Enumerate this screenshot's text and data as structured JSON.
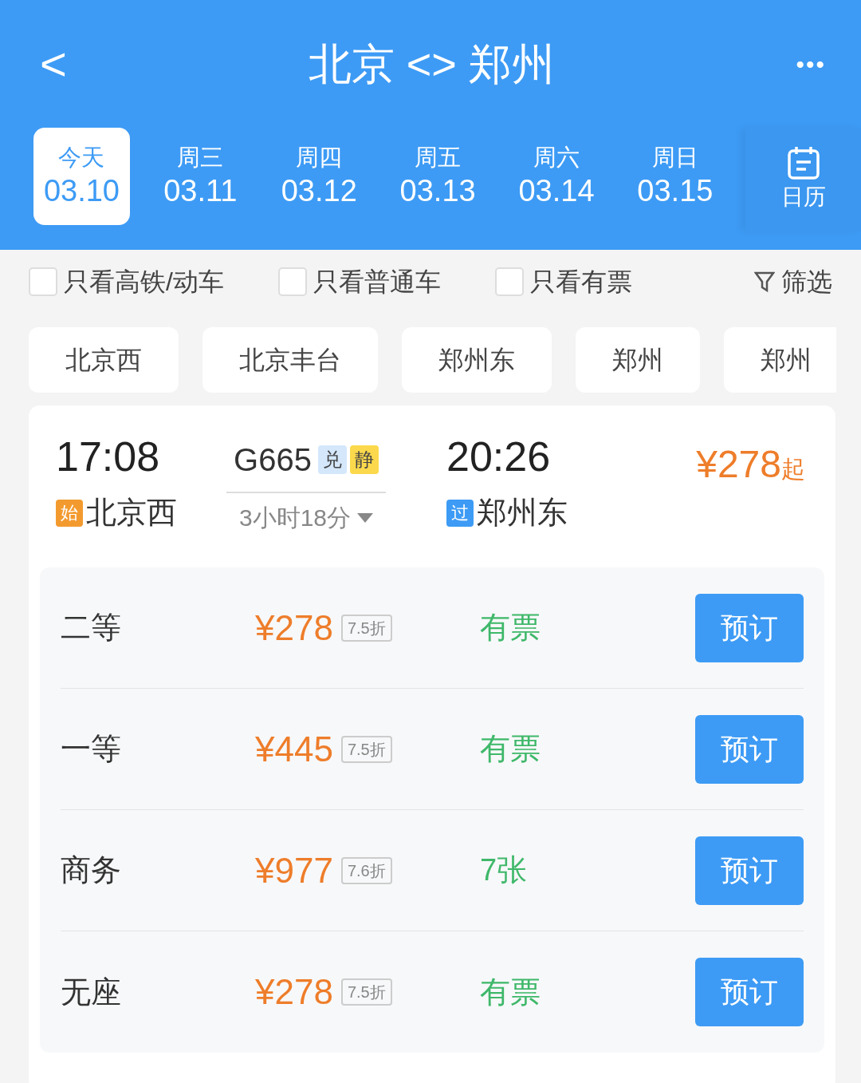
{
  "header": {
    "back": "<",
    "title": "北京 <> 郑州",
    "more": "•••"
  },
  "dates": [
    {
      "weekday": "今天",
      "date": "03.10",
      "selected": true
    },
    {
      "weekday": "周三",
      "date": "03.11",
      "selected": false
    },
    {
      "weekday": "周四",
      "date": "03.12",
      "selected": false
    },
    {
      "weekday": "周五",
      "date": "03.13",
      "selected": false
    },
    {
      "weekday": "周六",
      "date": "03.14",
      "selected": false
    },
    {
      "weekday": "周日",
      "date": "03.15",
      "selected": false
    }
  ],
  "calendar_label": "日历",
  "filters": [
    {
      "label": "只看高铁/动车",
      "checked": false
    },
    {
      "label": "只看普通车",
      "checked": false
    },
    {
      "label": "只看有票",
      "checked": false
    }
  ],
  "filter_button": "筛选",
  "stations": [
    "北京西",
    "北京丰台",
    "郑州东",
    "郑州",
    "郑州"
  ],
  "train": {
    "depart_time": "17:08",
    "depart_station": {
      "tag": "始",
      "kind": "start",
      "name": "北京西"
    },
    "number": "G665",
    "tags": [
      {
        "text": "兑",
        "color": "#d4e7fb"
      },
      {
        "text": "静",
        "color": "#fcd94c"
      }
    ],
    "duration": "3小时18分",
    "arrive_time": "20:26",
    "arrive_station": {
      "tag": "过",
      "kind": "pass",
      "name": "郑州东"
    },
    "price": "¥278",
    "price_suffix": "起",
    "seats": [
      {
        "name": "二等",
        "price": "¥278",
        "discount": "7.5折",
        "availability": "有票",
        "button": "预订"
      },
      {
        "name": "一等",
        "price": "¥445",
        "discount": "7.5折",
        "availability": "有票",
        "button": "预订"
      },
      {
        "name": "商务",
        "price": "¥977",
        "discount": "7.6折",
        "availability": "7张",
        "button": "预订"
      },
      {
        "name": "无座",
        "price": "¥278",
        "discount": "7.5折",
        "availability": "有票",
        "button": "预订"
      }
    ]
  }
}
